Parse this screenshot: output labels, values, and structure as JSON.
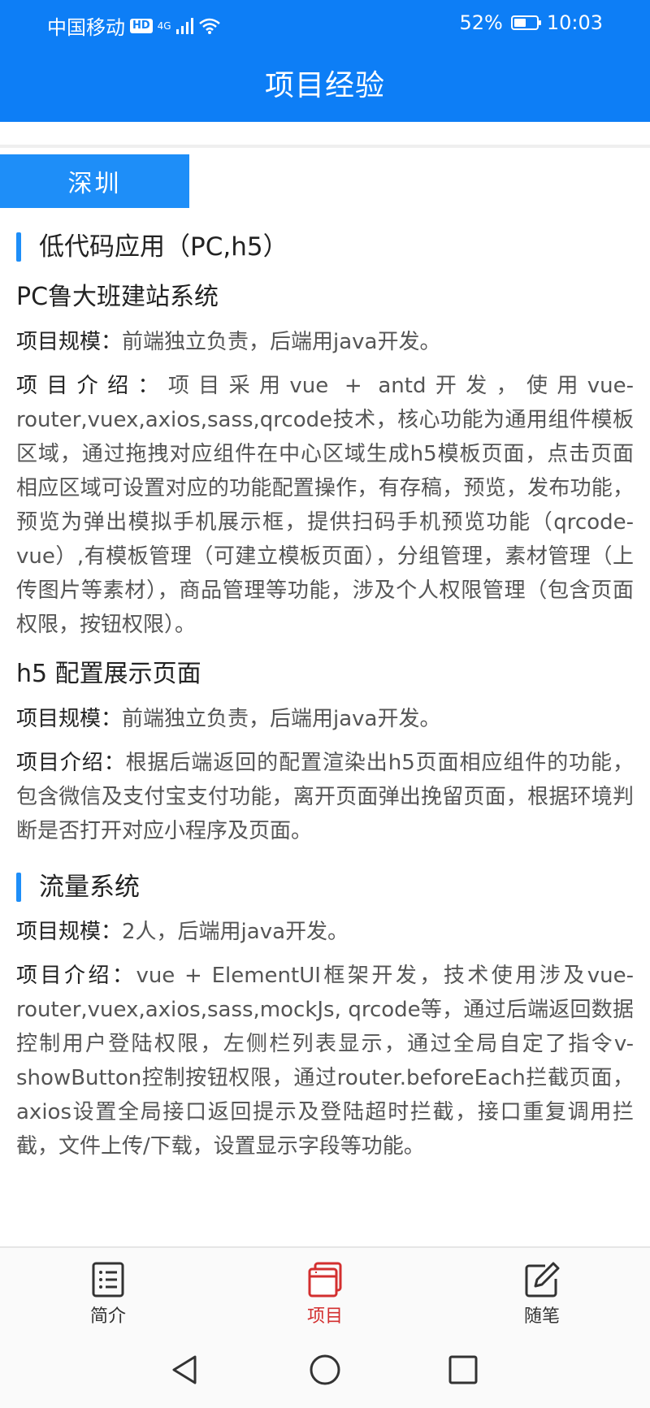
{
  "status_bar": {
    "carrier": "中国移动",
    "hd_badge": "HD",
    "network": "4G",
    "battery_percent": "52%",
    "battery_level": 0.52,
    "time": "10:03"
  },
  "header": {
    "title": "项目经验"
  },
  "city_tag": "深圳",
  "sections": [
    {
      "heading": "低代码应用（PC,h5）",
      "projects": [
        {
          "title": "PC鲁大班建站系统",
          "scale_label": "项目规模：",
          "scale_text": "前端独立负责，后端用java开发。",
          "intro_label": "项目介绍：",
          "intro_text": "项目采用vue + antd开发，使用vue-router,vuex,axios,sass,qrcode技术，核心功能为通用组件模板区域，通过拖拽对应组件在中心区域生成h5模板页面，点击页面相应区域可设置对应的功能配置操作，有存稿，预览，发布功能，预览为弹出模拟手机展示框，提供扫码手机预览功能（qrcode-vue）,有模板管理（可建立模板页面），分组管理，素材管理（上传图片等素材），商品管理等功能，涉及个人权限管理（包含页面权限，按钮权限）。"
        },
        {
          "title": "h5 配置展示页面",
          "scale_label": "项目规模：",
          "scale_text": "前端独立负责，后端用java开发。",
          "intro_label": "项目介绍：",
          "intro_text": "根据后端返回的配置渲染出h5页面相应组件的功能，包含微信及支付宝支付功能，离开页面弹出挽留页面，根据环境判断是否打开对应小程序及页面。"
        }
      ]
    },
    {
      "heading": "流量系统",
      "projects": [
        {
          "scale_label": "项目规模：",
          "scale_text": "2人，后端用java开发。",
          "intro_label": "项目介绍：",
          "intro_text": "vue + ElementUI框架开发，技术使用涉及vue-router,vuex,axios,sass,mockJs, qrcode等，通过后端返回数据控制用户登陆权限，左侧栏列表显示，通过全局自定了指令v-showButton控制按钮权限，通过router.beforeEach拦截页面，axios设置全局接口返回提示及登陆超时拦截，接口重复调用拦截，文件上传/下载，设置显示字段等功能。"
        }
      ]
    }
  ],
  "tabbar": {
    "items": [
      {
        "label": "简介",
        "icon": "list-icon"
      },
      {
        "label": "项目",
        "icon": "project-stack-icon",
        "active": true
      },
      {
        "label": "随笔",
        "icon": "edit-icon"
      }
    ]
  },
  "colors": {
    "primary": "#0d7ef6",
    "accent_bar": "#1e8ef8",
    "active_tab": "#d32f2f"
  }
}
